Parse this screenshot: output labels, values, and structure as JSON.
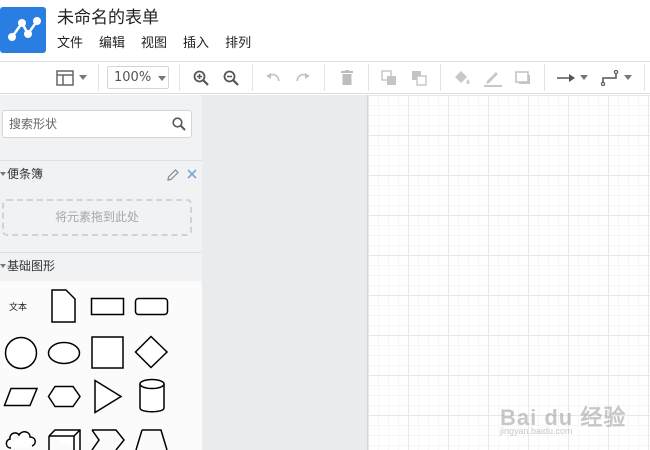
{
  "header": {
    "logo_icon": "diagram-share-icon",
    "title": "未命名的表单"
  },
  "menu": [
    "文件",
    "编辑",
    "视图",
    "插入",
    "排列"
  ],
  "toolbar": {
    "zoom": "100%",
    "icons": [
      "panel-layout-icon",
      "zoom-in-icon",
      "zoom-out-icon",
      "undo-icon",
      "redo-icon",
      "delete-icon",
      "to-front-icon",
      "to-back-icon",
      "fill-color-icon",
      "line-color-icon",
      "shadow-icon",
      "connection-arrow-icon",
      "waypoint-style-icon"
    ]
  },
  "sidebar": {
    "search_placeholder": "搜索形状",
    "scratchpad": {
      "title": "便条簿",
      "drop_hint": "将元素拖到此处"
    },
    "general": {
      "title": "基础图形",
      "text_shape_label": "文本"
    }
  },
  "watermark": {
    "brand": "Bai du 经验",
    "url": "jingyan.baidu.com"
  },
  "colors": {
    "logo": "#2a7de1",
    "sidebar_bg": "#f1f2f4",
    "canvas_bg": "#eaebed"
  }
}
